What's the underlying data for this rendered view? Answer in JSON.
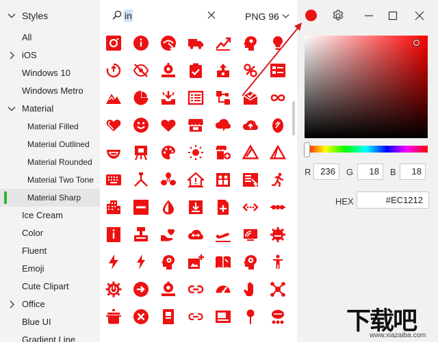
{
  "sidebar": {
    "header": "Styles",
    "items": [
      {
        "label": "All",
        "level": 0,
        "expand": ""
      },
      {
        "label": "iOS",
        "level": 0,
        "expand": "collapsed"
      },
      {
        "label": "Windows 10",
        "level": 0,
        "expand": ""
      },
      {
        "label": "Windows Metro",
        "level": 0,
        "expand": ""
      },
      {
        "label": "Material",
        "level": 0,
        "expand": "expanded"
      },
      {
        "label": "Material Filled",
        "level": 1,
        "expand": ""
      },
      {
        "label": "Material Outlined",
        "level": 1,
        "expand": ""
      },
      {
        "label": "Material Rounded",
        "level": 1,
        "expand": ""
      },
      {
        "label": "Material Two Tone",
        "level": 1,
        "expand": ""
      },
      {
        "label": "Material Sharp",
        "level": 1,
        "expand": "",
        "selected": true
      },
      {
        "label": "Ice Cream",
        "level": 0,
        "expand": ""
      },
      {
        "label": "Color",
        "level": 0,
        "expand": ""
      },
      {
        "label": "Fluent",
        "level": 0,
        "expand": ""
      },
      {
        "label": "Emoji",
        "level": 0,
        "expand": ""
      },
      {
        "label": "Cute Clipart",
        "level": 0,
        "expand": ""
      },
      {
        "label": "Office",
        "level": 0,
        "expand": "collapsed"
      },
      {
        "label": "Blue UI",
        "level": 0,
        "expand": ""
      },
      {
        "label": "Gradient Line",
        "level": 0,
        "expand": ""
      }
    ]
  },
  "search": {
    "value": "in"
  },
  "format": {
    "label": "PNG 96"
  },
  "icons": {
    "color": "#EC1212",
    "grid": [
      [
        "instagram",
        "info",
        "remove-red-eye-cursor",
        "local-shipping",
        "trending-up",
        "psychology",
        "emoji-objects"
      ],
      [
        "restart-alt",
        "visibility-off",
        "settings-suggest",
        "assignment-turned-in",
        "cast-connected",
        "link-off",
        "ballot"
      ],
      [
        "landscape",
        "pie-chart",
        "move-to-inbox",
        "list-alt",
        "account-tree",
        "mark-email-read",
        "all-inclusive"
      ],
      [
        "favorite-border-heart",
        "emoji-emotions",
        "favorite",
        "storefront",
        "cloud-comment",
        "cloud-upload",
        "egg-alt"
      ],
      [
        "sentiment",
        "easel",
        "palette",
        "wb-sunny",
        "add-business",
        "change-history",
        "change-history-outline"
      ],
      [
        "keyboard",
        "camera-tripod",
        "toys-fan",
        "home-alert",
        "reduce-capacity",
        "menu-open",
        "directions-run"
      ],
      [
        "apartment",
        "indeterminate",
        "opacity",
        "vertical-align-bottom",
        "note-add",
        "settings-ethernet",
        "linear-scale"
      ],
      [
        "info-outline-box",
        "flag-stand",
        "volunteer-activism",
        "settings-ethernet-cloud",
        "flight-takeoff",
        "connected-tv",
        "settings-cog-alt"
      ],
      [
        "bolt",
        "flash-on",
        "psychology-alt",
        "add-photo",
        "menu-book",
        "psychology-gear",
        "emoji-people"
      ],
      [
        "settings-power",
        "arrow-circle-right",
        "settings-suggest-alt",
        "link",
        "speed",
        "pan-tool",
        "hub"
      ],
      [
        "cookie-pot",
        "cancel",
        "menu-book-alt",
        "link-alt",
        "featured-video",
        "push-pin",
        "coronavirus"
      ]
    ]
  },
  "color_picker": {
    "swatch_color": "#EC1212",
    "hue_position": 0.0,
    "saturation": 0.92,
    "value": 0.93,
    "r_label": "R",
    "r": "236",
    "g_label": "G",
    "g": "18",
    "b_label": "B",
    "b": "18",
    "hex_label": "HEX",
    "hex": "#EC1212"
  },
  "watermark": {
    "logo": "下载吧",
    "url": "www.xiazaiba.com"
  }
}
